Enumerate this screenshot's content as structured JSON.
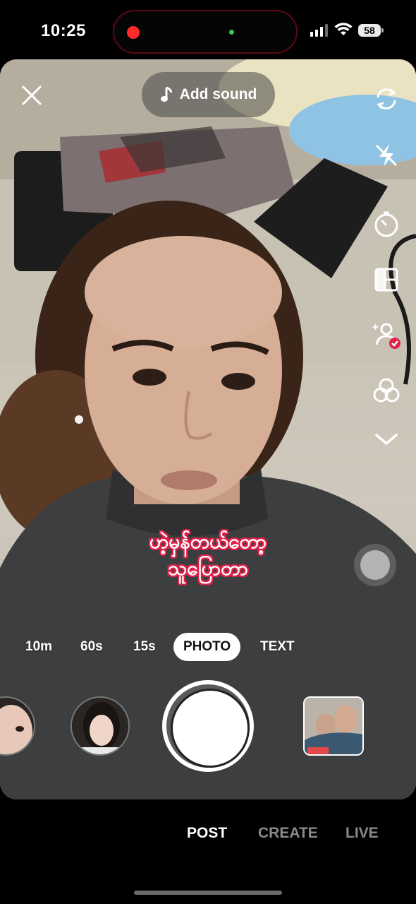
{
  "status_bar": {
    "time": "10:25",
    "battery": "58",
    "recording_color": "#ff2a2a",
    "camera_indicator_color": "#35d04b"
  },
  "camera": {
    "add_sound_label": "Add sound",
    "caption_lines": [
      "ဟဲ့မှန်တယ်တော့",
      "သူပြောတာ"
    ],
    "right_rail_icons": [
      "flip-camera-icon",
      "flash-off-icon",
      "timer-icon",
      "layout-icon",
      "collab-icon",
      "effects-icon",
      "chevron-down-icon"
    ]
  },
  "modes": {
    "items": [
      "10m",
      "60s",
      "15s",
      "PHOTO",
      "TEXT"
    ],
    "selected": "PHOTO"
  },
  "bottom_nav": {
    "tabs": [
      "POST",
      "CREATE",
      "LIVE"
    ],
    "active": "POST"
  },
  "colors": {
    "caption_stroke": "#e0224a",
    "verified_badge": "#e0224a"
  }
}
